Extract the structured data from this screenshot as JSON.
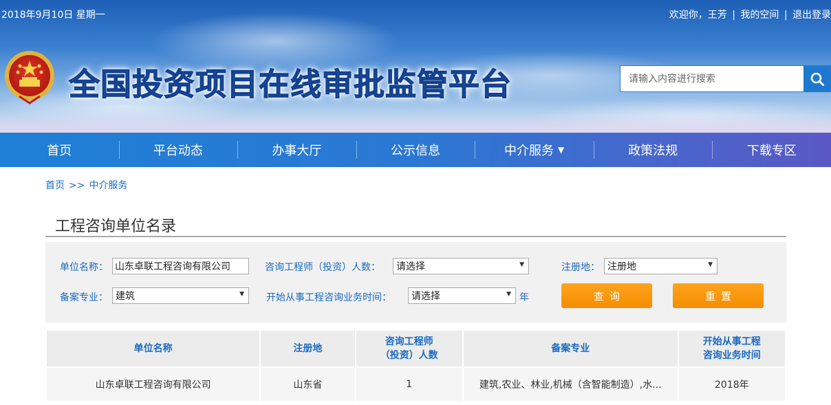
{
  "top": {
    "date": "2018年9月10日 星期一",
    "welcome": "欢迎你，王芳",
    "my_space": "我的空间",
    "logout": "退出登录",
    "separator": "|"
  },
  "header": {
    "site_title": "全国投资项目在线审批监管平台",
    "search_placeholder": "请输入内容进行搜索",
    "search_icon": "search-icon",
    "emblem_icon": "national-emblem-icon"
  },
  "nav": {
    "items": [
      {
        "label": "首页"
      },
      {
        "label": "平台动态"
      },
      {
        "label": "办事大厅"
      },
      {
        "label": "公示信息"
      },
      {
        "label": "中介服务",
        "caret": "▼"
      },
      {
        "label": "政策法规"
      },
      {
        "label": "下载专区"
      }
    ]
  },
  "breadcrumb": {
    "home": "首页",
    "separator": ">>",
    "current": "中介服务"
  },
  "page": {
    "title": "工程咨询单位名录"
  },
  "filters": {
    "unit_name_label": "单位名称：",
    "unit_name_value": "山东卓联工程咨询有限公司",
    "engineers_label": "咨询工程师（投资）人数：",
    "engineers_value": "请选择",
    "region_label": "注册地：",
    "region_value": "注册地",
    "specialty_label": "备案专业：",
    "specialty_value": "建筑",
    "start_time_label": "开始从事工程咨询业务时间：",
    "start_time_value": "请选择",
    "year_suffix": "年",
    "query_button": "查询",
    "reset_button": "重置"
  },
  "table": {
    "headers": {
      "unit_name": "单位名称",
      "region": "注册地",
      "engineers_line1": "咨询工程师",
      "engineers_line2": "（投资）人数",
      "specialty": "备案专业",
      "start_time_line1": "开始从事工程",
      "start_time_line2": "咨询业务时间"
    },
    "rows": [
      {
        "unit_name": "山东卓联工程咨询有限公司",
        "region": "山东省",
        "engineers": "1",
        "specialty": "建筑,农业、林业,机械（含智能制造）,水...",
        "start_time": "2018年"
      }
    ]
  },
  "colors": {
    "nav_start": "#1e7fd6",
    "nav_end": "#5a58c4",
    "link_blue": "#1a6ac1",
    "button_orange": "#f79600"
  }
}
